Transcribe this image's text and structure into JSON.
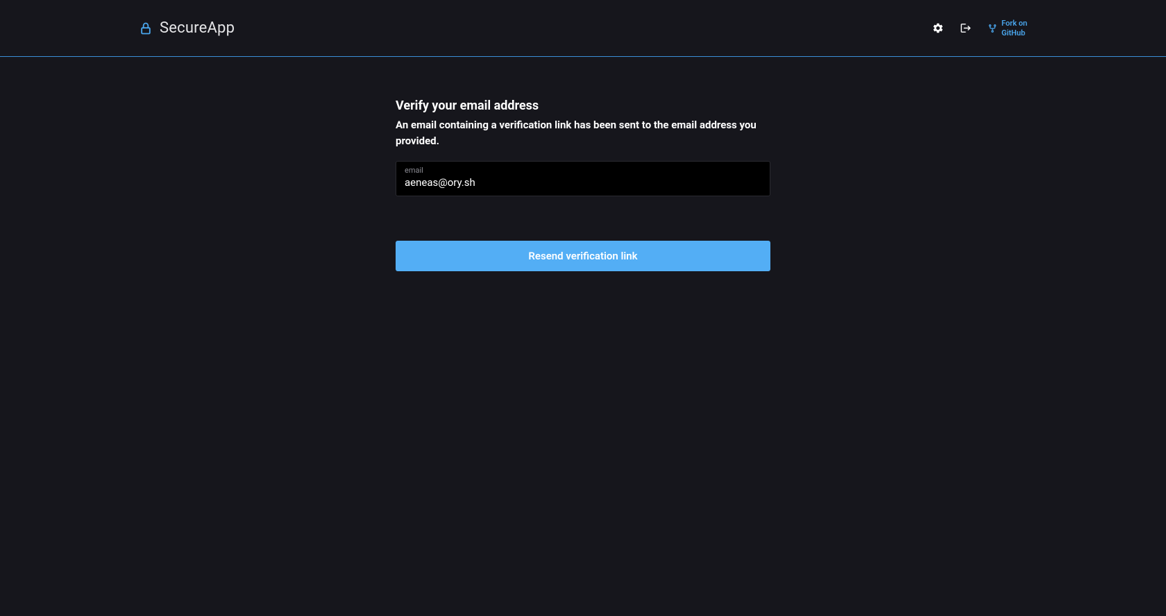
{
  "header": {
    "brand": "SecureApp",
    "fork_label": "Fork on\nGitHub"
  },
  "main": {
    "title": "Verify your email address",
    "subtitle": "An email containing a verification link has been sent to the email address you provided.",
    "email_label": "email",
    "email_value": "aeneas@ory.sh",
    "resend_button": "Resend verification link"
  },
  "colors": {
    "accent": "#53aef5",
    "link": "#4aa7ee",
    "bg": "#16161c"
  }
}
